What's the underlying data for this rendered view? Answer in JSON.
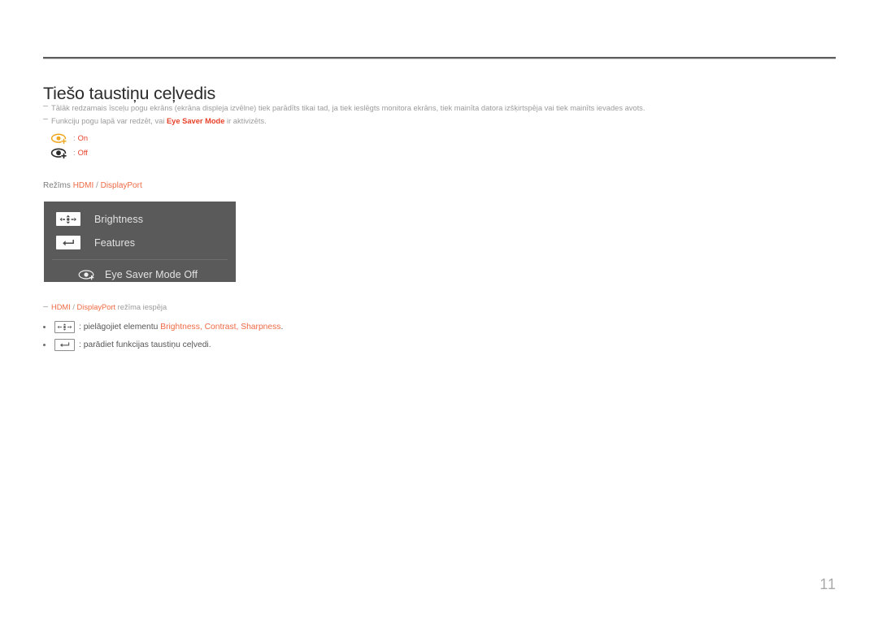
{
  "document": {
    "title": "Tiešo taustiņu ceļvedis",
    "page_number": "11"
  },
  "notes": [
    {
      "pre": "Tālāk redzamais īsceļu pogu ekrāns (ekrāna displeja izvēlne) tiek parādīts tikai tad, ja tiek ieslēgts monitora ekrāns, tiek mainīta datora izšķirtspēja vai tiek mainīts ievades avots.",
      "highlight": "",
      "post": ""
    },
    {
      "pre": "Funkciju pogu lapā var redzēt, vai ",
      "highlight": "Eye Saver Mode",
      "post": " ir aktivizēts."
    }
  ],
  "legend": [
    {
      "icon": "eye-saver-on-icon",
      "separator": ":",
      "label": "On",
      "color": "#f0a922"
    },
    {
      "icon": "eye-saver-off-icon",
      "separator": ":",
      "label": "Off",
      "color": "#2b2b2b"
    }
  ],
  "mode_label": {
    "prefix": "Režīms",
    "first": "HDMI",
    "slash": "/",
    "second": "DisplayPort"
  },
  "osd": {
    "items": [
      {
        "icon": "joystick-4way-icon",
        "label": "Brightness"
      },
      {
        "icon": "enter-return-icon",
        "label": "Features"
      }
    ],
    "footer": {
      "icon": "eye-saver-mode-icon",
      "label": "Eye Saver Mode Off"
    },
    "background_color": "#5a5a5a"
  },
  "foot_note": {
    "first": "HDMI",
    "slash": "/",
    "second": "DisplayPort",
    "rest": " režīma iespēja"
  },
  "bullets": [
    {
      "icon": "joystick-4way-icon",
      "separator": ":",
      "pre": " pielāgojiet elementu ",
      "items": "Brightness, Contrast, Sharpness",
      "post": "."
    },
    {
      "icon": "enter-return-icon",
      "separator": ":",
      "pre": " parādiet funkcijas taustiņu ceļvedi.",
      "items": "",
      "post": ""
    }
  ],
  "colors": {
    "accent_red": "#e8412a",
    "accent_orange": "#ef6a44",
    "muted_gray": "#9b9b9b",
    "osd_gray": "#5a5a5a"
  }
}
